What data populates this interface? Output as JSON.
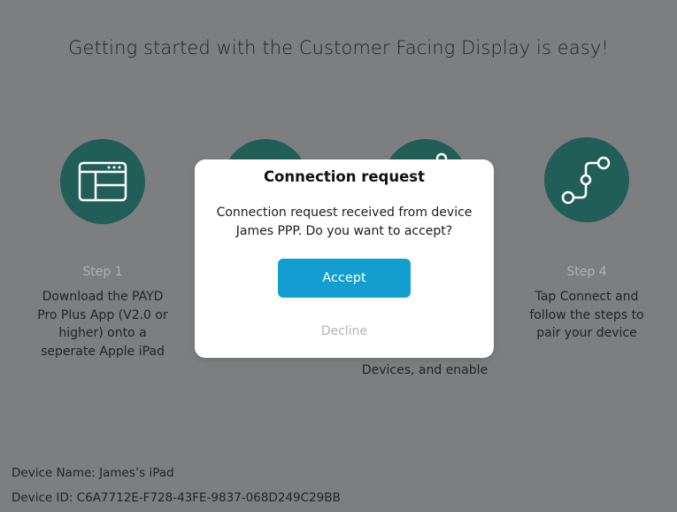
{
  "page": {
    "headline": "Getting started with the Customer Facing Display is easy!"
  },
  "steps": [
    {
      "icon": "window-layout-icon",
      "label": "Step 1",
      "text": "Download the PAYD\nPro Plus App (V2.0 or\nhigher) onto a\nseperate Apple iPad"
    },
    {
      "icon": "step-2-icon",
      "label": "",
      "text": ""
    },
    {
      "icon": "step-3-icon",
      "label": "",
      "text": "Devices, and enable"
    },
    {
      "icon": "connection-path-icon",
      "label": "Step 4",
      "text": "Tap Connect and\nfollow the steps to\npair your device"
    }
  ],
  "footer": {
    "device_name": "Device Name:  James’s iPad",
    "device_id": "Device ID:  C6A7712E-F728-43FE-9837-068D249C29BB"
  },
  "dialog": {
    "title": "Connection request",
    "message": "Connection request received from device\nJames PPP. Do you want to accept?",
    "accept_label": "Accept",
    "decline_label": "Decline"
  },
  "colors": {
    "overlay_background": "#7d7e80",
    "icon_circle": "#205e57",
    "accent": "#129fcf",
    "dialog_background": "#ffffff"
  }
}
